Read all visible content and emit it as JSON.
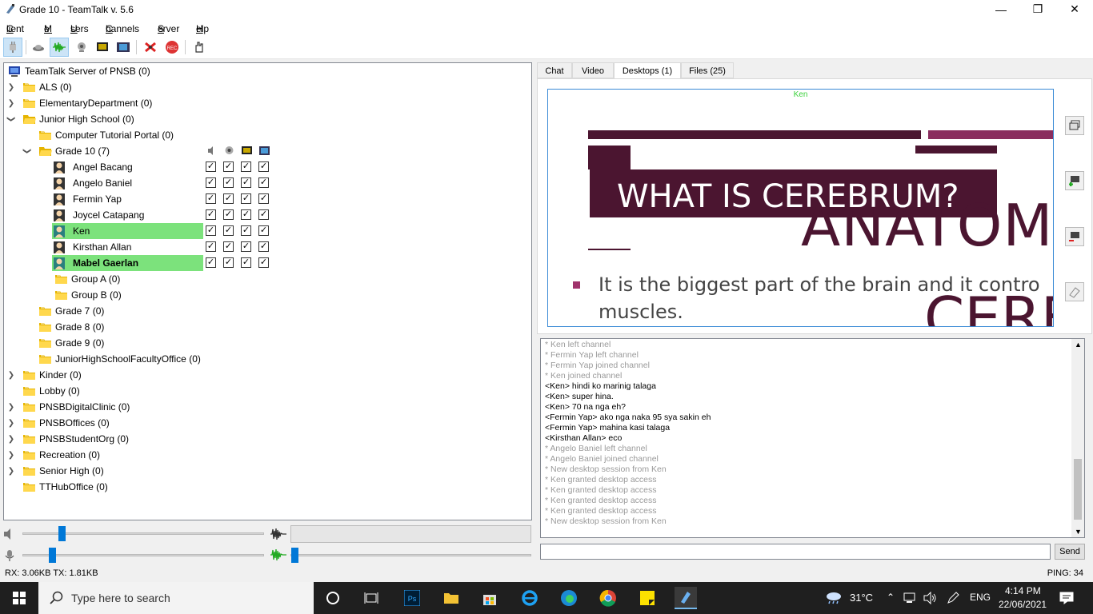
{
  "window": {
    "title": "Grade 10 - TeamTalk v. 5.6",
    "minimize": "—",
    "maximize": "❐",
    "close": "✕"
  },
  "menu": [
    {
      "ul": "C",
      "rest": "lient"
    },
    {
      "ul": "M",
      "rest": "e"
    },
    {
      "ul": "U",
      "rest": "sers"
    },
    {
      "ul": "C",
      "rest": "hannels"
    },
    {
      "ul": "S",
      "rest": "erver"
    },
    {
      "ul": "H",
      "rest": "elp"
    }
  ],
  "tree": {
    "server": "TeamTalk Server of PNSB (0)",
    "als": "ALS (0)",
    "elementary": "ElementaryDepartment (0)",
    "junior_high": "Junior High School (0)",
    "computer_tutorial": "Computer Tutorial Portal (0)",
    "grade10": "Grade 10 (7)",
    "users": [
      "Angel Bacang",
      "Angelo Baniel",
      "Fermin Yap",
      "Joycel Catapang",
      "Ken",
      "Kirsthan Allan",
      "Mabel Gaerlan"
    ],
    "group_a": "Group A (0)",
    "group_b": "Group B (0)",
    "grade7": "Grade 7 (0)",
    "grade8": "Grade 8 (0)",
    "grade9": "Grade 9 (0)",
    "faculty": "JuniorHighSchoolFacultyOffice (0)",
    "kinder": "Kinder (0)",
    "lobby": "Lobby (0)",
    "digital_clinic": "PNSBDigitalClinic (0)",
    "offices": "PNSBOffices (0)",
    "studentorg": "PNSBStudentOrg (0)",
    "recreation": "Recreation (0)",
    "senior_high": "Senior High (0)",
    "tthub": "TTHubOffice (0)"
  },
  "checkmark": "✓",
  "status": {
    "rxtx": "RX: 3.06KB TX: 1.81KB",
    "ping": "PING: 34"
  },
  "tabs": [
    "Chat",
    "Video",
    "Desktops (1)",
    "Files (25)"
  ],
  "desktop": {
    "owner": "Ken",
    "slide_title": "WHAT IS CEREBRUM?",
    "bg_word": "ANATOM",
    "bg_word2": "CERE",
    "bullet": "It is the biggest part of the brain and it contro",
    "bullet2": "muscles."
  },
  "chat": [
    {
      "t": "* Ken left channel",
      "sys": true
    },
    {
      "t": "* Fermin Yap left channel",
      "sys": true
    },
    {
      "t": "* Fermin Yap joined channel",
      "sys": true
    },
    {
      "t": "* Ken joined channel",
      "sys": true
    },
    {
      "t": "<Ken> hindi ko marinig talaga",
      "sys": false
    },
    {
      "t": "<Ken> super hina.",
      "sys": false
    },
    {
      "t": "<Ken> 70 na nga eh?",
      "sys": false
    },
    {
      "t": "<Fermin Yap> ako nga naka 95 sya sakin eh",
      "sys": false
    },
    {
      "t": "<Fermin Yap> mahina kasi talaga",
      "sys": false
    },
    {
      "t": "<Kirsthan Allan> eco",
      "sys": false
    },
    {
      "t": "* Angelo Baniel  left channel",
      "sys": true
    },
    {
      "t": "* Angelo Baniel  joined channel",
      "sys": true
    },
    {
      "t": "* New desktop session from Ken",
      "sys": true
    },
    {
      "t": "* Ken granted desktop access",
      "sys": true
    },
    {
      "t": "* Ken granted desktop access",
      "sys": true
    },
    {
      "t": "* Ken granted desktop access",
      "sys": true
    },
    {
      "t": "* Ken granted desktop access",
      "sys": true
    },
    {
      "t": "* New desktop session from Ken",
      "sys": true
    }
  ],
  "send_label": "Send",
  "taskbar": {
    "search_placeholder": "Type here to search",
    "weather": "31°C",
    "lang": "ENG",
    "time": "4:14 PM",
    "date": "22/06/2021"
  }
}
